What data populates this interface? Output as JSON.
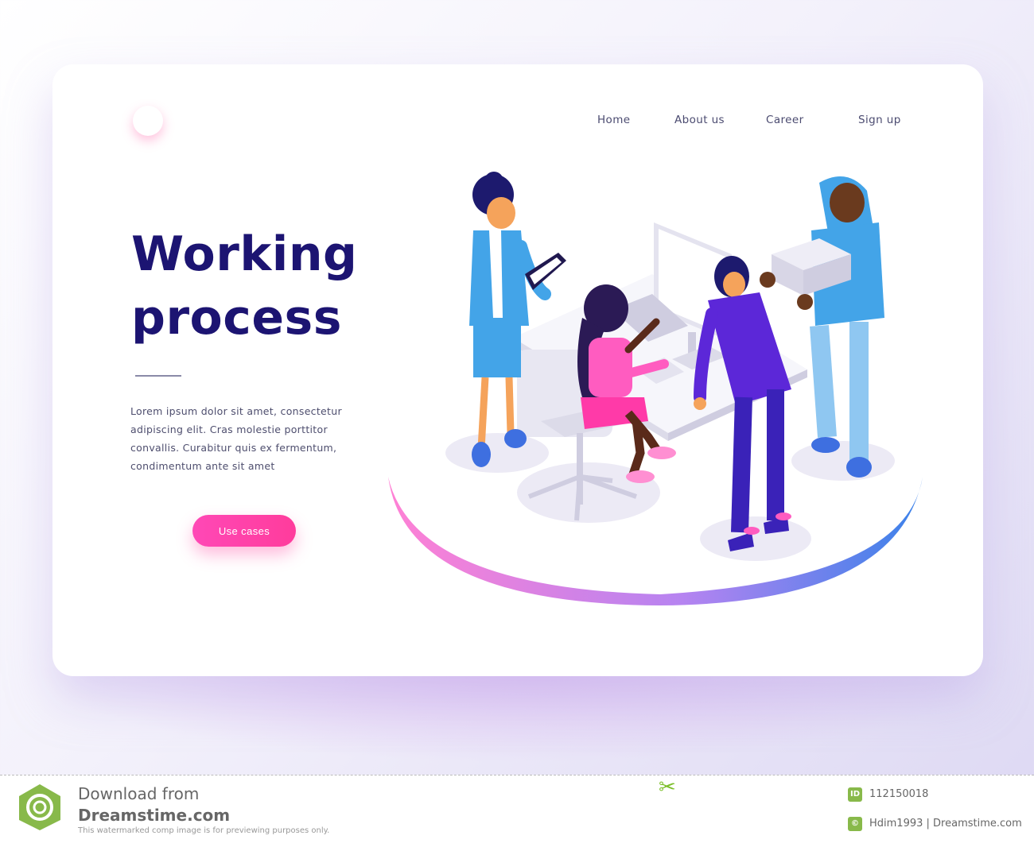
{
  "nav": {
    "items": [
      "Home",
      "About us",
      "Career",
      "Sign up"
    ]
  },
  "hero": {
    "title_line1": "Working",
    "title_line2": "process",
    "description": "Lorem ipsum dolor sit amet, consectetur adipiscing elit. Cras molestie porttitor convallis. Curabitur quis ex fermentum, condimentum ante sit amet",
    "cta_label": "Use cases"
  },
  "footer": {
    "download_from": "Download from",
    "site": "Dreamstime.com",
    "note": "This watermarked comp image is for previewing purposes only.",
    "id_badge": "ID",
    "image_id": "112150018",
    "credit": "Hdim1993 | Dreamstime.com"
  },
  "colors": {
    "title": "#1c1472",
    "accent_pink": "#ff3c9c",
    "accent_blue": "#3d7fe8",
    "brand_green": "#88b94a"
  }
}
